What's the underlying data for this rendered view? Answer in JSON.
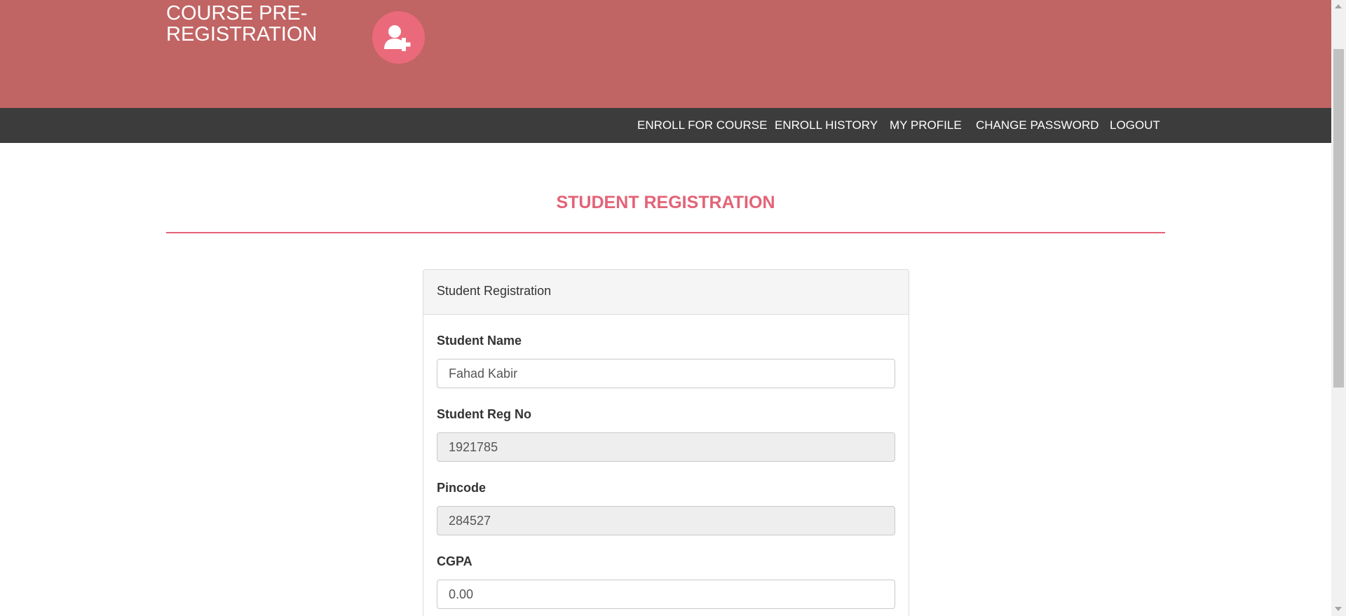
{
  "header": {
    "logo_text_line1": "COURSE PRE-",
    "logo_text_line2": "REGISTRATION",
    "logo_icon": "user-plus-icon",
    "bg_color": "#c16464",
    "icon_circle_color": "#ea6a7c"
  },
  "nav": {
    "items": [
      {
        "label": "ENROLL FOR COURSE"
      },
      {
        "label": "ENROLL HISTORY"
      },
      {
        "label": "MY PROFILE"
      },
      {
        "label": "CHANGE PASSWORD"
      },
      {
        "label": "LOGOUT"
      }
    ],
    "bg_color": "#3c3c3c"
  },
  "main": {
    "heading": "STUDENT REGISTRATION",
    "accent_color": "#e36377",
    "panel": {
      "title": "Student Registration",
      "fields": [
        {
          "label": "Student Name",
          "value": "Fahad Kabir",
          "readonly": false
        },
        {
          "label": "Student Reg No",
          "value": "1921785",
          "readonly": true
        },
        {
          "label": "Pincode",
          "value": "284527",
          "readonly": true
        },
        {
          "label": "CGPA",
          "value": "0.00",
          "readonly": false
        }
      ]
    }
  }
}
